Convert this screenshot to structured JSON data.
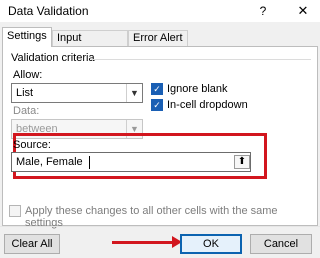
{
  "window": {
    "title": "Data Validation",
    "help_glyph": "?",
    "close_glyph": "✕"
  },
  "tabs": [
    {
      "label": "Settings",
      "active": true
    },
    {
      "label": "Input Message",
      "active": false
    },
    {
      "label": "Error Alert",
      "active": false
    }
  ],
  "criteria": {
    "heading": "Validation criteria",
    "allow_label": "Allow:",
    "allow_value": "List",
    "data_label": "Data:",
    "data_value": "between",
    "ignore_blank_label": "Ignore blank",
    "ignore_blank_checked": true,
    "in_cell_dropdown_label": "In-cell dropdown",
    "in_cell_dropdown_checked": true,
    "source_label": "Source:",
    "source_value": "Male, Female"
  },
  "apply_all": {
    "label": "Apply these changes to all other cells with the same settings",
    "checked": false
  },
  "buttons": {
    "clear_all": "Clear All",
    "ok": "OK",
    "cancel": "Cancel"
  },
  "annotation_color": "#d2161e"
}
